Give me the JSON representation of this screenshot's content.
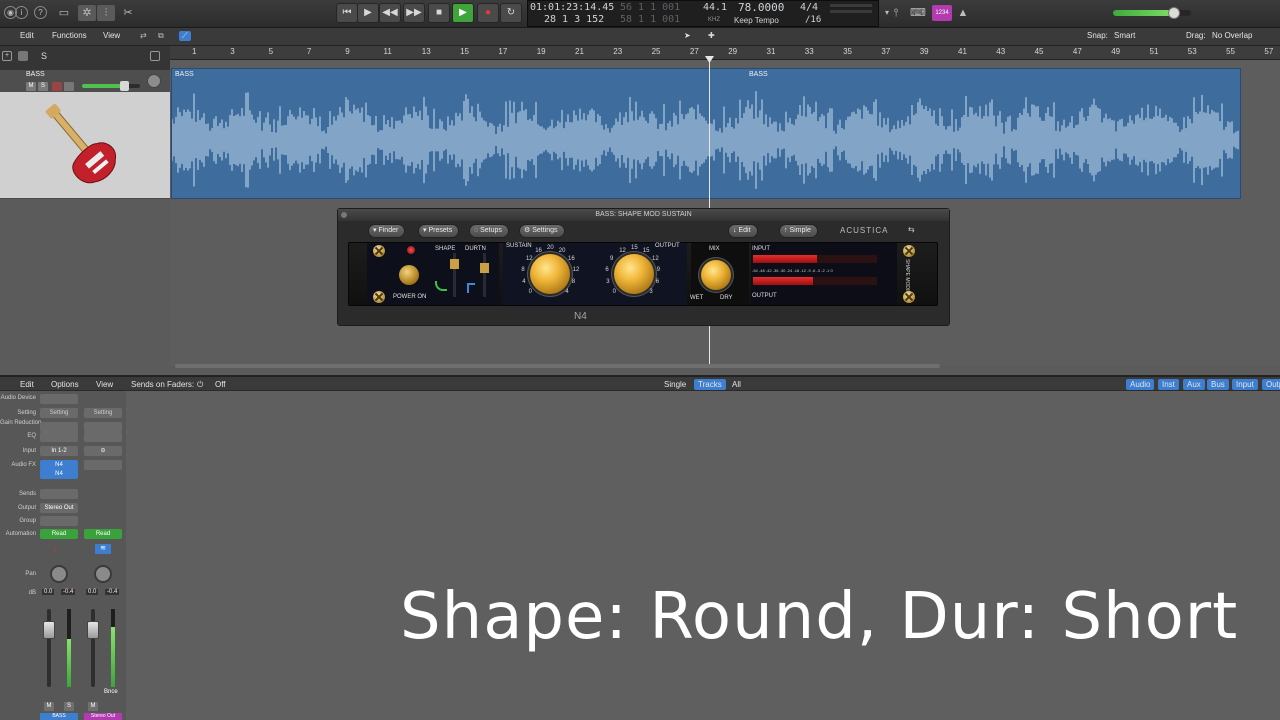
{
  "transport": {
    "time_smpte": "01:01:23:14.45",
    "time_bars": "28  1  3  152",
    "dim_top": "56  1  1  001",
    "dim_bottom": "58  1  1  001",
    "tempo_khz": "44.1",
    "tempo": "78.0000",
    "tempo_mode": "Keep Tempo",
    "time_sig": "4/4",
    "division": "/16",
    "count_in": "1234"
  },
  "editbar": {
    "edit": "Edit",
    "functions": "Functions",
    "view": "View",
    "snap_label": "Snap:",
    "snap_value": "Smart",
    "drag_label": "Drag:",
    "drag_value": "No Overlap"
  },
  "ruler_ticks": [
    "1",
    "3",
    "5",
    "7",
    "9",
    "11",
    "13",
    "15",
    "17",
    "19",
    "21",
    "23",
    "25",
    "27",
    "29",
    "31",
    "33",
    "35",
    "37",
    "39",
    "41",
    "43",
    "45",
    "47",
    "49",
    "51",
    "53",
    "55",
    "57"
  ],
  "track": {
    "name": "BASS",
    "mute": "M",
    "solo": "S",
    "region_name": "BASS",
    "region_name_2": "BASS",
    "header_s": "S"
  },
  "plugin": {
    "title": "BASS: SHAPE MOD SUSTAIN",
    "finder": "Finder",
    "presets": "Presets",
    "setups": "Setups",
    "settings": "Settings",
    "edit": "Edit",
    "simple": "Simple",
    "brand": "ACUSTICA",
    "footer": "N4",
    "shape": "SHAPE",
    "durtn": "DURTN",
    "sustain": "SUSTAIN",
    "output": "OUTPUT",
    "mix": "MIX",
    "input": "INPUT",
    "output2": "OUTPUT",
    "power": "POWER ON",
    "wet": "WET",
    "dry": "DRY",
    "side": "SHAPE MODIFIER",
    "meter_scale": "-54  -48  -42  -36  -30  -24  -18  -12  -9  -6  -3  -2  -1  0",
    "sustain_scale": [
      "0",
      "4",
      "8",
      "12",
      "16",
      "20",
      "20",
      "16",
      "12",
      "8",
      "4"
    ],
    "output_scale": [
      "0",
      "3",
      "6",
      "9",
      "12",
      "15",
      "15",
      "12",
      "9",
      "6",
      "3"
    ]
  },
  "mixbar": {
    "edit": "Edit",
    "options": "Options",
    "view": "View",
    "sends_on_faders": "Sends on Faders:",
    "off": "Off",
    "single": "Single",
    "tracks": "Tracks",
    "all": "All",
    "filters": [
      "Audio",
      "Inst",
      "Aux",
      "Bus",
      "Input",
      "Output"
    ]
  },
  "mixer": {
    "labels": [
      "Audio Device",
      "Setting",
      "Gain Reduction",
      "EQ",
      "Input",
      "Audio FX",
      "Sends",
      "Output",
      "Group",
      "Automation",
      "Pan",
      "dB"
    ],
    "strip1": {
      "setting": "Setting",
      "input": "In 1-2",
      "fx1": "N4",
      "fx2": "N4",
      "output": "Stereo Out",
      "automation": "Read",
      "db": "0.0",
      "peak": "-0.4",
      "name": "BASS",
      "m": "M",
      "s": "S"
    },
    "strip2": {
      "setting": "Setting",
      "automation": "Read",
      "db": "0.0",
      "peak": "-0.4",
      "name": "Stereo Out",
      "m": "M",
      "bnce": "Bnce"
    }
  },
  "caption": "Shape: Round, Dur: Short",
  "colors": {
    "region": "#3e6c9c",
    "accent": "#3d7ed0",
    "knob": "#f0b73a",
    "play": "#3fa53a"
  },
  "meters": {
    "master_volume_fraction": 0.78,
    "track_volume_fraction": 0.72
  }
}
